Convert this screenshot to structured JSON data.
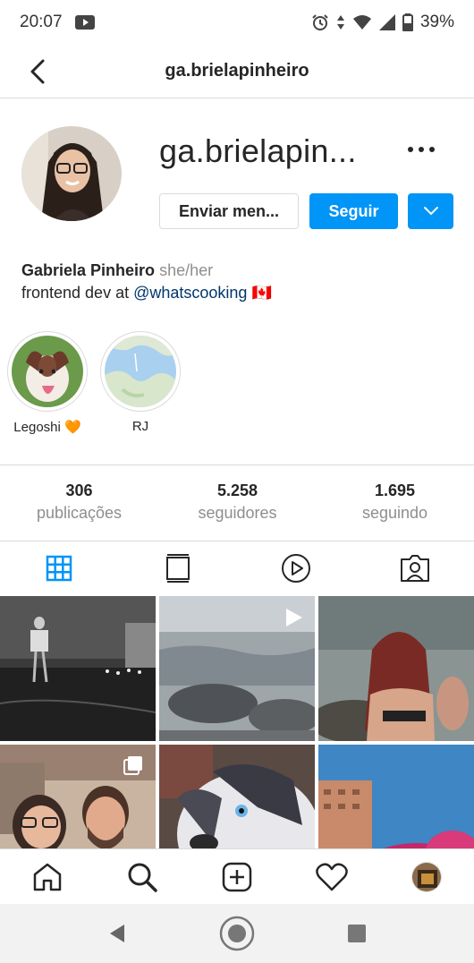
{
  "status_bar": {
    "time": "20:07",
    "battery": "39%",
    "icons": [
      "youtube-icon",
      "alarm-icon",
      "data-arrows-icon",
      "wifi-icon",
      "signal-icon",
      "battery-icon"
    ]
  },
  "header": {
    "title": "ga.brielapinheiro",
    "back_icon": "back-arrow-icon"
  },
  "profile": {
    "username_display": "ga.brielapin...",
    "message_button": "Enviar men...",
    "follow_button": "Seguir",
    "dropdown_icon": "chevron-down-icon",
    "more_icon": "more-dots-icon",
    "name": "Gabriela Pinheiro",
    "pronouns": "she/her",
    "bio_prefix": "frontend dev at ",
    "bio_mention": "@whatscooking",
    "bio_emoji": "🇨🇦"
  },
  "highlights": [
    {
      "label": "Legoshi 🧡"
    },
    {
      "label": "RJ"
    }
  ],
  "stats": [
    {
      "value": "306",
      "label": "publicações"
    },
    {
      "value": "5.258",
      "label": "seguidores"
    },
    {
      "value": "1.695",
      "label": "seguindo"
    }
  ],
  "tabs": [
    "grid-icon",
    "feed-icon",
    "reels-icon",
    "tagged-icon"
  ],
  "bottom_nav": [
    "home-icon",
    "search-icon",
    "new-post-icon",
    "heart-icon",
    "profile-avatar"
  ],
  "colors": {
    "accent": "#0095f6",
    "text": "#262626",
    "secondary": "#8e8e8e",
    "border": "#dbdbdb",
    "mention": "#00376b"
  }
}
